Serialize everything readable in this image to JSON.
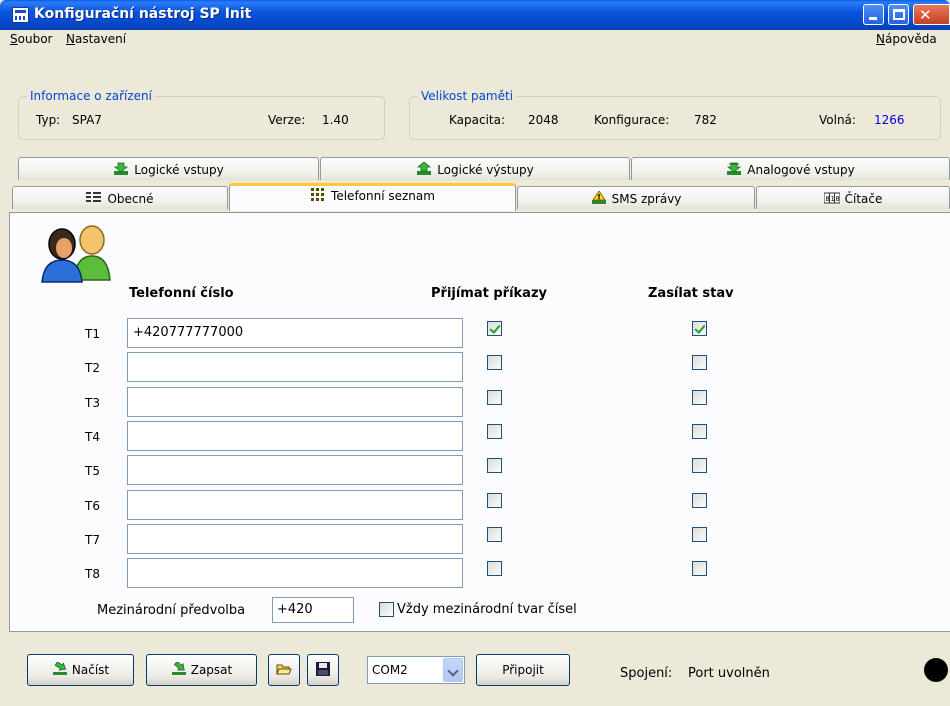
{
  "window": {
    "title": "Konfigurační nástroj SP Init"
  },
  "menu": {
    "file": "Soubor",
    "settings": "Nastavení",
    "help": "Nápověda"
  },
  "device_info": {
    "legend": "Informace o zařízení",
    "type_label": "Typ:",
    "type_value": "SPA7",
    "version_label": "Verze:",
    "version_value": "1.40"
  },
  "memory": {
    "legend": "Velikost paměti",
    "capacity_label": "Kapacita:",
    "capacity_value": "2048",
    "config_label": "Konfigurace:",
    "config_value": "782",
    "free_label": "Volná:",
    "free_value": "1266",
    "free_color": "#0000e0"
  },
  "tabs_top": [
    {
      "label": "Logické vstupy",
      "icon": "logic-input-icon"
    },
    {
      "label": "Logické výstupy",
      "icon": "logic-output-icon"
    },
    {
      "label": "Analogové vstupy",
      "icon": "analog-input-icon"
    }
  ],
  "tabs_bottom": [
    {
      "label": "Obecné",
      "icon": "general-icon"
    },
    {
      "label": "Telefonní seznam",
      "icon": "phonebook-icon",
      "active": true
    },
    {
      "label": "SMS zprávy",
      "icon": "sms-warning-icon"
    },
    {
      "label": "Čítače",
      "icon": "counter-icon"
    }
  ],
  "phonebook": {
    "col_number": "Telefonní číslo",
    "col_accept": "Přijímat příkazy",
    "col_send": "Zasílat stav",
    "rows": [
      {
        "label": "T1",
        "number": "+420777777000",
        "accept": true,
        "send": true
      },
      {
        "label": "T2",
        "number": "",
        "accept": false,
        "send": false
      },
      {
        "label": "T3",
        "number": "",
        "accept": false,
        "send": false
      },
      {
        "label": "T4",
        "number": "",
        "accept": false,
        "send": false
      },
      {
        "label": "T5",
        "number": "",
        "accept": false,
        "send": false
      },
      {
        "label": "T6",
        "number": "",
        "accept": false,
        "send": false
      },
      {
        "label": "T7",
        "number": "",
        "accept": false,
        "send": false
      },
      {
        "label": "T8",
        "number": "",
        "accept": false,
        "send": false
      }
    ],
    "prefix_label": "Mezinárodní předvolba",
    "prefix_value": "+420",
    "intl_format_label": "Vždy mezinárodní tvar čísel",
    "intl_format_checked": false
  },
  "footer": {
    "load_label": "Načíst",
    "write_label": "Zapsat",
    "port_value": "COM2",
    "connect_label": "Připojit",
    "connection_label": "Spojení:",
    "connection_value": "Port uvolněn",
    "status_color": "#000000"
  }
}
